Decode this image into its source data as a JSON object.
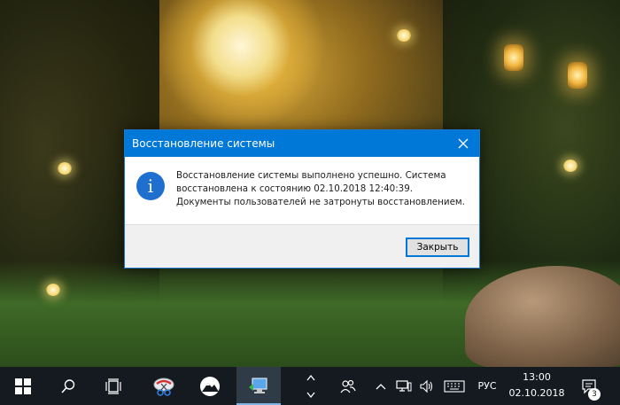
{
  "dialog": {
    "title": "Восстановление системы",
    "message": "Восстановление системы выполнено успешно. Система восстановлена к состоянию 02.10.2018 12:40:39. Документы пользователей не затронуты восстановлением.",
    "close_button": "Закрыть",
    "icon": "info-icon"
  },
  "taskbar": {
    "language": "РУС",
    "time": "13:00",
    "date": "02.10.2018",
    "notification_count": "3",
    "items": [
      "start-icon",
      "search-icon",
      "task-view-icon",
      "scissors-app-icon",
      "mountain-app-icon",
      "system-restore-app-icon"
    ],
    "tray_icons": [
      "people-icon",
      "chevron-up-icon",
      "network-icon",
      "volume-icon",
      "keyboard-icon"
    ]
  },
  "colors": {
    "titlebar": "#0078d7",
    "taskbar": "#151a20",
    "info_icon": "#1f6fcf"
  }
}
